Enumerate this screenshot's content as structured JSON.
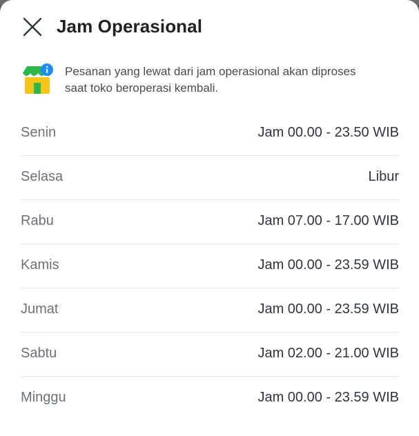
{
  "header": {
    "title": "Jam Operasional",
    "close_icon": "close-icon"
  },
  "notice": {
    "icon": "store-info-icon",
    "text_line1": "Pesanan yang lewat dari jam operasional akan diproses",
    "text_line2": "saat toko beroperasi kembali."
  },
  "schedule": [
    {
      "day": "Senin",
      "hours": "Jam 00.00 - 23.50 WIB"
    },
    {
      "day": "Selasa",
      "hours": "Libur"
    },
    {
      "day": "Rabu",
      "hours": "Jam 07.00 - 17.00 WIB"
    },
    {
      "day": "Kamis",
      "hours": "Jam 00.00 - 23.59 WIB"
    },
    {
      "day": "Jumat",
      "hours": "Jam 00.00 - 23.59 WIB"
    },
    {
      "day": "Sabtu",
      "hours": "Jam 02.00 - 21.00 WIB"
    },
    {
      "day": "Minggu",
      "hours": "Jam 00.00 - 23.59 WIB"
    }
  ],
  "colors": {
    "icon_green": "#2db84c",
    "icon_yellow": "#f5c518",
    "icon_info_blue": "#1a8cff",
    "day_text": "#6d7075",
    "hours_text": "#31353b"
  }
}
